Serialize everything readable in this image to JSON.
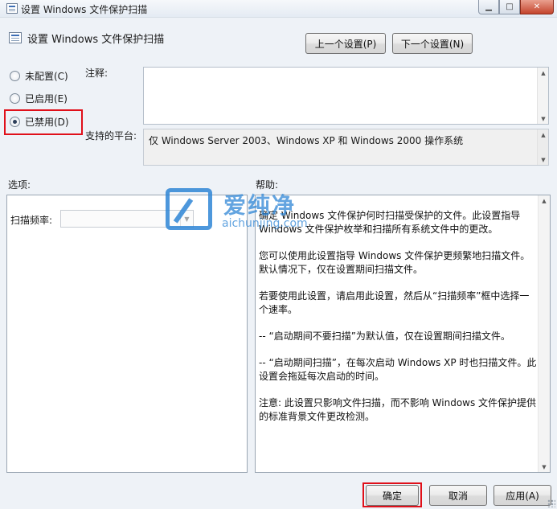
{
  "window": {
    "title": "设置 Windows 文件保护扫描",
    "min_glyph": "▁",
    "max_glyph": "□",
    "close_glyph": "✕"
  },
  "header": {
    "title": "设置 Windows 文件保护扫描",
    "prev_button": "上一个设置(P)",
    "next_button": "下一个设置(N)"
  },
  "state": {
    "options": [
      {
        "label": "未配置(C)",
        "checked": false
      },
      {
        "label": "已启用(E)",
        "checked": false
      },
      {
        "label": "已禁用(D)",
        "checked": true
      }
    ]
  },
  "comment": {
    "label": "注释:",
    "value": ""
  },
  "platform": {
    "label": "支持的平台:",
    "value": "仅 Windows Server 2003、Windows XP 和 Windows 2000 操作系统"
  },
  "options_panel": {
    "title": "选项:",
    "scan_freq_label": "扫描频率:",
    "scan_freq_value": ""
  },
  "help_panel": {
    "title": "帮助:",
    "paragraphs": [
      "确定 Windows 文件保护何时扫描受保护的文件。此设置指导 Windows 文件保护枚举和扫描所有系统文件中的更改。",
      "您可以使用此设置指导 Windows 文件保护更频繁地扫描文件。默认情况下，仅在设置期间扫描文件。",
      "若要使用此设置，请启用此设置，然后从“扫描频率”框中选择一个速率。",
      "-- “启动期间不要扫描”为默认值，仅在设置期间扫描文件。",
      "-- “启动期间扫描”，在每次启动 Windows XP 时也扫描文件。此设置会拖延每次启动的时间。",
      "注意: 此设置只影响文件扫描，而不影响 Windows 文件保护提供的标准背景文件更改检测。"
    ]
  },
  "watermark": {
    "cn": "爱纯净",
    "en": "aichunjing.com"
  },
  "footer": {
    "ok": "确定",
    "cancel": "取消",
    "apply": "应用(A)"
  },
  "colors": {
    "highlight": "#e0101a",
    "watermark": "#2f86d6"
  }
}
